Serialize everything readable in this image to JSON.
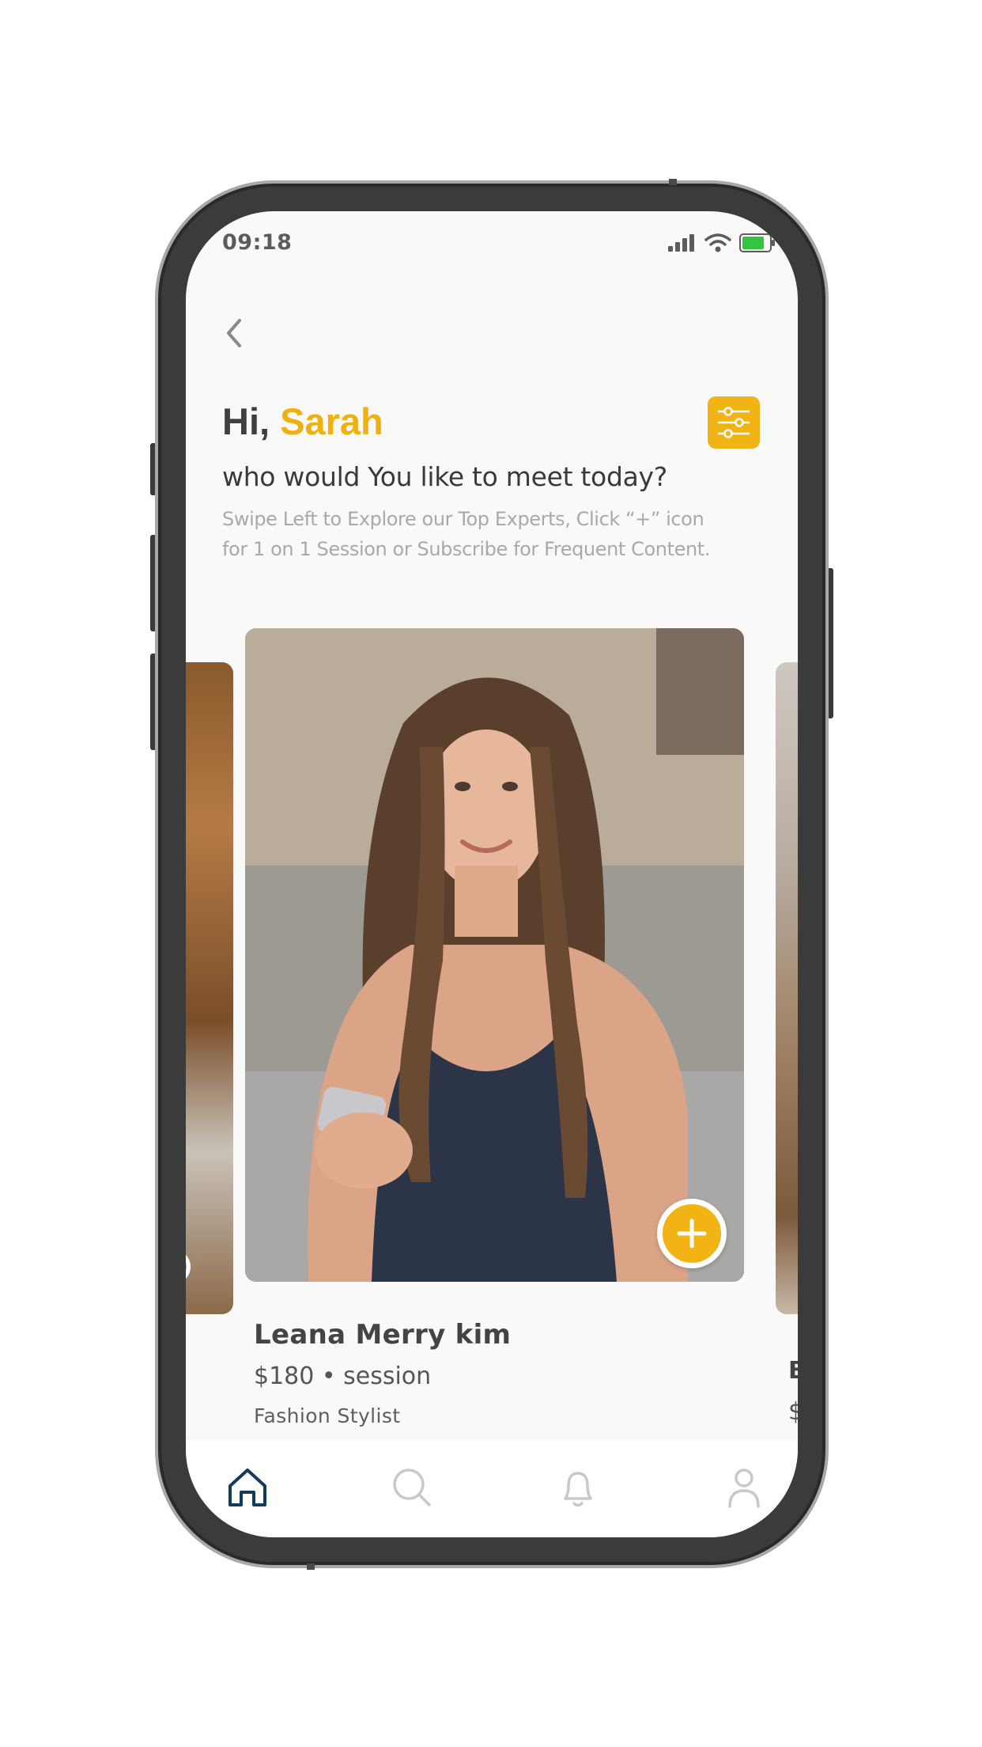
{
  "status_bar": {
    "time": "09:18",
    "icons": [
      "signal-icon",
      "wifi-icon",
      "battery-icon"
    ]
  },
  "header": {
    "greeting_prefix": "Hi, ",
    "user_name": "Sarah",
    "subtitle": "who would You like to meet today?",
    "hint_line1": "Swipe Left to Explore our Top Experts, Click “+” icon",
    "hint_line2": "for 1 on 1 Session or Subscribe for Frequent Content."
  },
  "featured_expert": {
    "name": "Leana Merry kim",
    "price": "$180 • session",
    "role": "Fashion Stylist"
  },
  "next_expert_peek": {
    "name_initial": "B",
    "price_initial": "$"
  },
  "tabs": [
    {
      "name": "home",
      "icon": "home-icon",
      "active": true
    },
    {
      "name": "search",
      "icon": "search-icon",
      "active": false
    },
    {
      "name": "notifications",
      "icon": "bell-icon",
      "active": false
    },
    {
      "name": "profile",
      "icon": "user-icon",
      "active": false
    }
  ],
  "colors": {
    "accent": "#f2b414",
    "name_highlight": "#f0b00f",
    "active_tab": "#123b5c",
    "inactive_tab": "#c9c9c9"
  }
}
